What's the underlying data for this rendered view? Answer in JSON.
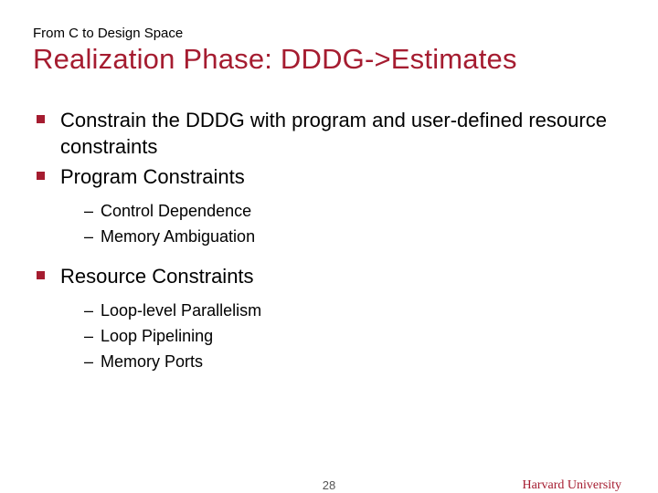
{
  "kicker": "From C to Design Space",
  "title": "Realization Phase: DDDG->Estimates",
  "bullets": {
    "b0": "Constrain the DDDG with program and user-defined resource constraints",
    "b1": "Program Constraints",
    "b1_sub": {
      "s0": "Control Dependence",
      "s1": "Memory Ambiguation"
    },
    "b2": "Resource Constraints",
    "b2_sub": {
      "s0": "Loop-level Parallelism",
      "s1": "Loop Pipelining",
      "s2": "Memory Ports"
    }
  },
  "page_number": "28",
  "affiliation": "Harvard University"
}
